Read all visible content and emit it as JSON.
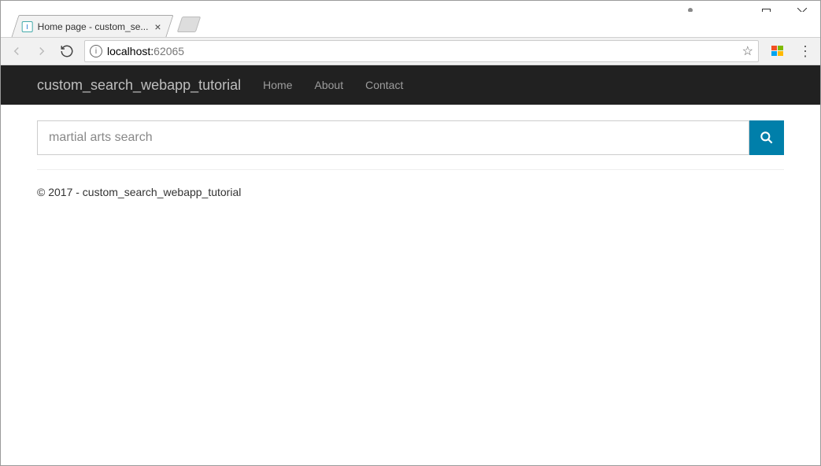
{
  "window": {
    "tab_title": "Home page - custom_se...",
    "url_host": "localhost:",
    "url_port": "62065"
  },
  "navbar": {
    "brand": "custom_search_webapp_tutorial",
    "links": [
      "Home",
      "About",
      "Contact"
    ]
  },
  "search": {
    "placeholder": "martial arts search"
  },
  "footer": {
    "text": "© 2017 - custom_search_webapp_tutorial"
  }
}
